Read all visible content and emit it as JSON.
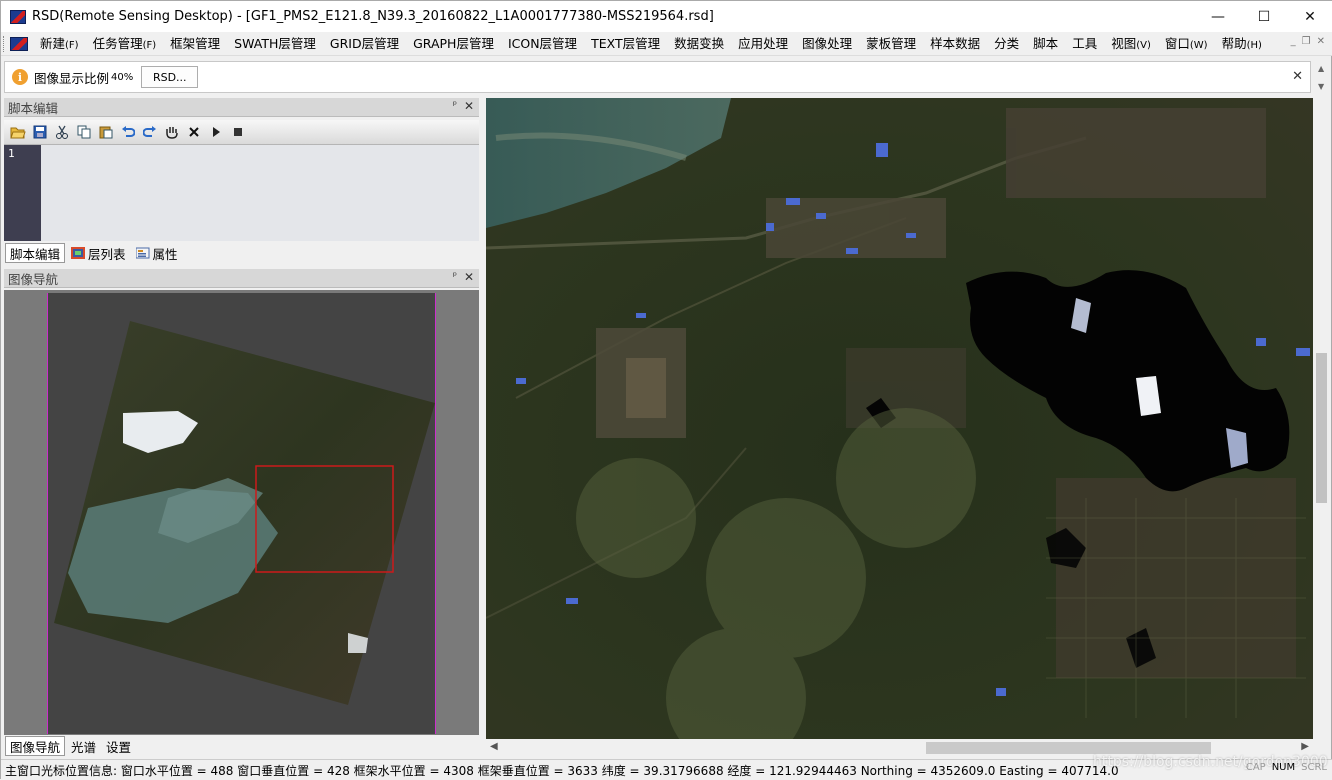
{
  "window": {
    "title": "RSD(Remote Sensing Desktop) - [GF1_PMS2_E121.8_N39.3_20160822_L1A0001777380-MSS219564.rsd]",
    "min_label": "—",
    "max_label": "☐",
    "close_label": "✕"
  },
  "menu": {
    "items": [
      {
        "label": "新建",
        "accel": "(F)"
      },
      {
        "label": "任务管理",
        "accel": "(F)"
      },
      {
        "label": "框架管理",
        "accel": ""
      },
      {
        "label": "SWATH层管理",
        "accel": ""
      },
      {
        "label": "GRID层管理",
        "accel": ""
      },
      {
        "label": "GRAPH层管理",
        "accel": ""
      },
      {
        "label": "ICON层管理",
        "accel": ""
      },
      {
        "label": "TEXT层管理",
        "accel": ""
      },
      {
        "label": "数据变换",
        "accel": ""
      },
      {
        "label": "应用处理",
        "accel": ""
      },
      {
        "label": "图像处理",
        "accel": ""
      },
      {
        "label": "蒙板管理",
        "accel": ""
      },
      {
        "label": "样本数据",
        "accel": ""
      },
      {
        "label": "分类",
        "accel": ""
      },
      {
        "label": "脚本",
        "accel": ""
      },
      {
        "label": "工具",
        "accel": ""
      },
      {
        "label": "视图",
        "accel": "(V)"
      },
      {
        "label": "窗口",
        "accel": "(W)"
      },
      {
        "label": "帮助",
        "accel": "(H)"
      }
    ],
    "mdi_min": "_",
    "mdi_restore": "❐",
    "mdi_close": "✕"
  },
  "infobar": {
    "icon": "i",
    "label": "图像显示比例",
    "percent": "40%",
    "button": "RSD...",
    "close": "✕"
  },
  "script_panel": {
    "title": "脚本编辑",
    "pin": "ᵖ",
    "close": "✕",
    "line_number": "1",
    "toolbar_icons": [
      "open-folder-icon",
      "save-icon",
      "cut-icon",
      "copy-icon",
      "paste-icon",
      "undo-icon",
      "redo-icon",
      "hand-icon",
      "stop-x-icon",
      "run-icon",
      "stop-icon"
    ]
  },
  "left_tabs_top": [
    {
      "label": "脚本编辑",
      "active": true
    },
    {
      "label": "层列表",
      "active": false
    },
    {
      "label": "属性",
      "active": false
    }
  ],
  "nav_panel": {
    "title": "图像导航",
    "pin": "ᵖ",
    "close": "✕"
  },
  "left_tabs_bottom": [
    {
      "label": "图像导航",
      "active": true
    },
    {
      "label": "光谱",
      "active": false
    },
    {
      "label": "设置",
      "active": false
    }
  ],
  "status": {
    "text": "主窗口光标位置信息:  窗口水平位置 = 488 窗口垂直位置 = 428 框架水平位置 = 4308 框架垂直位置 = 3633 纬度  = 39.31796688 经度  = 121.92944463 Northing = 4352609.0 Easting = 407714.0",
    "caps": "CAP",
    "num": "NUM",
    "scrl": "SCRL"
  },
  "watermark": "https://blog.csdn.net/gordon3000",
  "colors": {
    "nav_border": "#cc2fcc",
    "viewport_rect": "#cc1a1a",
    "info_icon": "#f0a030"
  }
}
